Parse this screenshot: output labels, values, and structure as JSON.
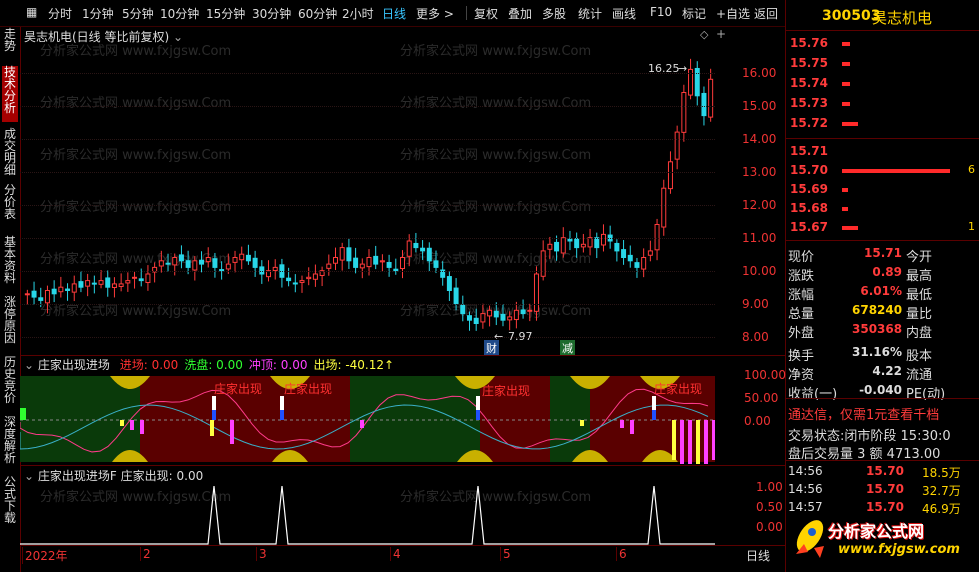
{
  "toolbar": {
    "periods": [
      "分时",
      "1分钟",
      "5分钟",
      "10分钟",
      "15分钟",
      "30分钟",
      "60分钟",
      "2小时",
      "日线",
      "更多 >"
    ],
    "active_period": "日线",
    "actions": [
      "复权",
      "叠加",
      "多股",
      "统计",
      "画线",
      "F10",
      "标记",
      "+自选",
      "返回"
    ]
  },
  "sidebar": {
    "tabs": [
      "分时走势",
      "技术分析",
      "成交明细",
      "分价表",
      "基本资料",
      "涨停原因",
      "历史竞价",
      "深度解析",
      "公式下载"
    ],
    "active": "技术分析"
  },
  "main_chart": {
    "title": "昊志机电(日线 等比前复权)",
    "high_label": "16.25",
    "low_label": "7.97",
    "marker_cai": "财",
    "marker_jian": "减",
    "y_ticks": [
      "16.00",
      "15.00",
      "14.00",
      "13.00",
      "12.00",
      "11.00",
      "10.00",
      "9.00",
      "8.00"
    ],
    "watermark": "分析家公式网 www.fxjgsw.Com"
  },
  "indicator1": {
    "name": "庄家出现进场",
    "fields": [
      {
        "label": "进场:",
        "value": "0.00",
        "color": "#ff3030"
      },
      {
        "label": "洗盘:",
        "value": "0.00",
        "color": "#30ff30"
      },
      {
        "label": "冲顶:",
        "value": "0.00",
        "color": "#ff40ff"
      },
      {
        "label": "出场:",
        "value": "-40.12↑",
        "color": "#ffff40"
      }
    ],
    "signal_text": "庄家出现",
    "y_ticks": [
      "100.00",
      "50.00",
      "0.00"
    ]
  },
  "indicator2": {
    "name": "庄家出现进场F",
    "field_label": "庄家出现:",
    "field_value": "0.00",
    "y_ticks": [
      "1.00",
      "0.50",
      "0.00"
    ]
  },
  "x_axis": {
    "labels": [
      "2022年",
      "2",
      "3",
      "4",
      "5",
      "6"
    ],
    "period_label": "日线"
  },
  "quote": {
    "code": "300503",
    "name": "昊志机电",
    "asks": [
      {
        "price": "15.76",
        "vol": ""
      },
      {
        "price": "15.75",
        "vol": ""
      },
      {
        "price": "15.74",
        "vol": ""
      },
      {
        "price": "15.73",
        "vol": ""
      },
      {
        "price": "15.72",
        "vol": ""
      }
    ],
    "bids": [
      {
        "price": "15.71",
        "vol": ""
      },
      {
        "price": "15.70",
        "vol": "6"
      },
      {
        "price": "15.69",
        "vol": ""
      },
      {
        "price": "15.68",
        "vol": ""
      },
      {
        "price": "15.67",
        "vol": "1"
      }
    ],
    "stats": [
      {
        "k": "现价",
        "v": "15.71",
        "k2": "今开",
        "color": "#ff3b3b"
      },
      {
        "k": "涨跌",
        "v": "0.89",
        "k2": "最高",
        "color": "#ff3b3b"
      },
      {
        "k": "涨幅",
        "v": "6.01%",
        "k2": "最低",
        "color": "#ff3b3b"
      },
      {
        "k": "总量",
        "v": "678240",
        "k2": "量比",
        "color": "#ffd400"
      },
      {
        "k": "外盘",
        "v": "350368",
        "k2": "内盘",
        "color": "#ff3b3b"
      },
      {
        "k": "换手",
        "v": "31.16%",
        "k2": "股本",
        "color": "#dddddd"
      },
      {
        "k": "净资",
        "v": "4.22",
        "k2": "流通",
        "color": "#dddddd"
      },
      {
        "k": "收益(一)",
        "v": "-0.040",
        "k2": "PE(动)",
        "color": "#dddddd"
      }
    ],
    "promo": "通达信，仅需1元查看千档",
    "trade_status_label": "交易状态:",
    "trade_status_value": "闭市阶段 15:30:0",
    "after_hours": "盘后交易量 3 额 4713.00",
    "ticks": [
      {
        "time": "14:56",
        "price": "15.70",
        "vol": "18.5万"
      },
      {
        "time": "14:56",
        "price": "15.70",
        "vol": "32.7万"
      },
      {
        "time": "14:57",
        "price": "15.70",
        "vol": "46.9万"
      }
    ],
    "logo_text": "分析家公式网",
    "logo_url": "www.fxjgsw.com"
  }
}
